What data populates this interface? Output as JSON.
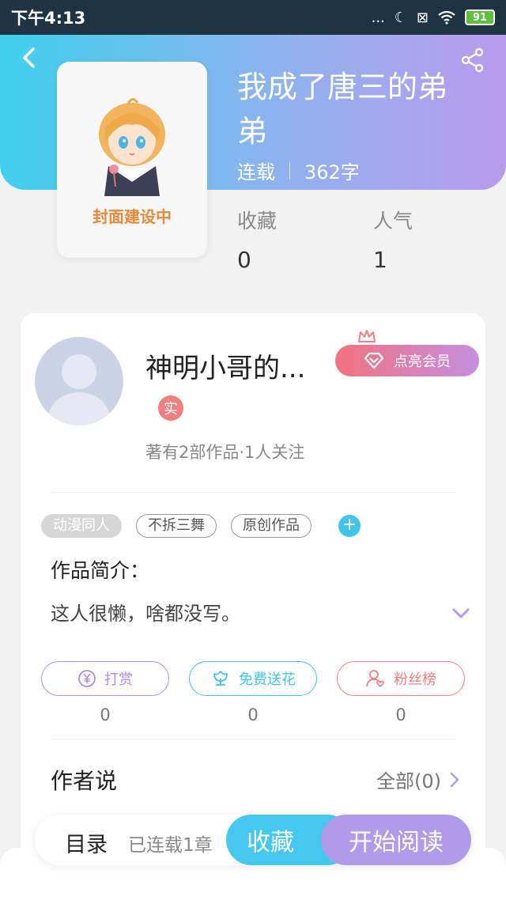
{
  "status_bar": {
    "time": "下午4:13",
    "dots": "...",
    "battery": "91"
  },
  "book": {
    "title": "我成了唐三的弟弟",
    "status": "连载",
    "word_count": "362字",
    "cover_text": "封面建设中",
    "stats": [
      {
        "label": "收藏",
        "value": "0"
      },
      {
        "label": "人气",
        "value": "1"
      }
    ]
  },
  "author": {
    "name": "神明小哥的...",
    "badge": "实",
    "works_info": "著有2部作品·1人关注",
    "vip_label": "点亮会员"
  },
  "tags": [
    "动漫同人",
    "不拆三舞",
    "原创作品"
  ],
  "intro": {
    "label": "作品简介：",
    "text": "这人很懒，啥都没写。"
  },
  "actions": [
    {
      "label": "打赏",
      "count": "0",
      "icon": "yen-coin-icon",
      "color": "#b38be6"
    },
    {
      "label": "免费送花",
      "count": "0",
      "icon": "flower-icon",
      "color": "#3fc4e8"
    },
    {
      "label": "粉丝榜",
      "count": "0",
      "icon": "fan-list-icon",
      "color": "#f08080"
    }
  ],
  "author_says": {
    "title": "作者说",
    "all_label": "全部(0)"
  },
  "bottom": {
    "toc": "目录",
    "chapters": "已连载1章",
    "collect": "收藏",
    "read": "开始阅读"
  },
  "colors": {
    "accent_blue": "#45c8ef",
    "accent_purple": "#b29aea",
    "accent_red": "#f08080"
  }
}
